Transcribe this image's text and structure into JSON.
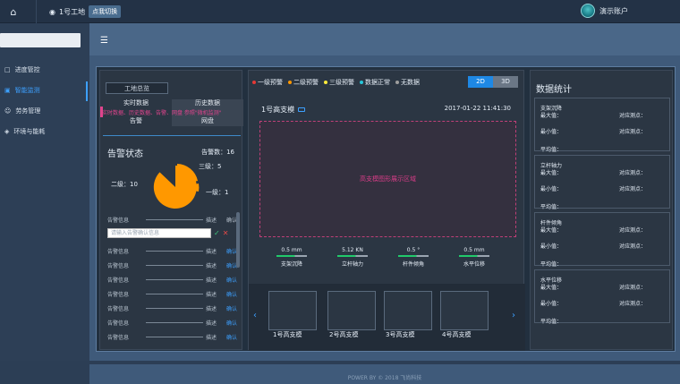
{
  "topbar": {
    "location": "1号工地",
    "switch_label": "点我切换",
    "user_name": "演示账户"
  },
  "sidebar": {
    "items": [
      {
        "label": "进度管控",
        "icon": "chart-icon"
      },
      {
        "label": "智能监测",
        "icon": "monitor-icon"
      },
      {
        "label": "劳务管理",
        "icon": "people-icon"
      },
      {
        "label": "环境与能耗",
        "icon": "leaf-icon"
      }
    ]
  },
  "left": {
    "overview_btn": "工地总览",
    "tab1_title": "实时数据",
    "tab1_sub": "告警",
    "tab2_title": "历史数据",
    "tab2_sub": "网盘",
    "pink_text": "实时数据、历史数据、告警、网盘 参照\"微机监测\"",
    "alert_title": "告警状态",
    "alert_count": "告警数：16",
    "pie": {
      "l1": "一级：1",
      "l2": "二级：10",
      "l3": "三级：5"
    },
    "list_header": {
      "info": "告警信息",
      "desc": "描述",
      "confirm": "确认"
    },
    "input_placeholder": "请输入告警确认信息",
    "rows": [
      {
        "info": "告警信息",
        "desc": "描述",
        "confirm": "确认"
      },
      {
        "info": "告警信息",
        "desc": "描述",
        "confirm": "确认"
      },
      {
        "info": "告警信息",
        "desc": "描述",
        "confirm": "确认"
      },
      {
        "info": "告警信息",
        "desc": "描述",
        "confirm": "确认"
      },
      {
        "info": "告警信息",
        "desc": "描述",
        "confirm": "确认"
      },
      {
        "info": "告警信息",
        "desc": "描述",
        "confirm": "确认"
      },
      {
        "info": "告警信息",
        "desc": "描述",
        "confirm": "确认"
      }
    ]
  },
  "mid": {
    "legend": [
      {
        "label": "一级预警",
        "color": "#e53935"
      },
      {
        "label": "二级预警",
        "color": "#ff9800"
      },
      {
        "label": "三级预警",
        "color": "#ffeb3b"
      },
      {
        "label": "数据正常",
        "color": "#26c6da"
      },
      {
        "label": "无数据",
        "color": "#9e9e9e"
      }
    ],
    "toggle": {
      "a": "2D",
      "b": "3D"
    },
    "title": "1号高支模",
    "time": "2017-01-22 11:41:30",
    "show_area": "高支模图形展示区域",
    "gauges": [
      {
        "value": "0.5 mm",
        "label": "支架沉降"
      },
      {
        "value": "5.12 KN",
        "label": "立杆轴力"
      },
      {
        "value": "0.5 °",
        "label": "杆件倾角"
      },
      {
        "value": "0.5 mm",
        "label": "水平位移"
      }
    ],
    "thumbs": [
      "1号高支模",
      "2号高支模",
      "3号高支模",
      "4号高支模"
    ]
  },
  "right": {
    "title": "数据统计",
    "cards": [
      {
        "title": "支架沉降",
        "max": "最大值：",
        "min": "最小值：",
        "avg": "平均值：",
        "point1": "对应测点：",
        "point2": "对应测点："
      },
      {
        "title": "立杆轴力",
        "max": "最大值：",
        "min": "最小值：",
        "avg": "平均值：",
        "point1": "对应测点：",
        "point2": "对应测点："
      },
      {
        "title": "杆件倾角",
        "max": "最大值：",
        "min": "最小值：",
        "avg": "平均值：",
        "point1": "对应测点：",
        "point2": "对应测点："
      },
      {
        "title": "水平位移",
        "max": "最大值：",
        "min": "最小值：",
        "avg": "平均值：",
        "point1": "对应测点：",
        "point2": "对应测点："
      }
    ]
  },
  "footer": {
    "text": "POWER BY © 2018 飞尚科技"
  }
}
